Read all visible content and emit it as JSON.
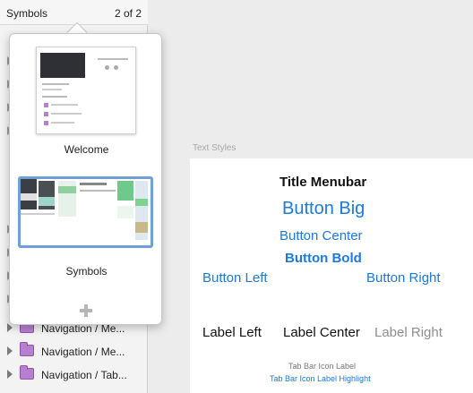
{
  "layers_panel": {
    "title": "Symbols",
    "page_counter": "2 of 2",
    "rows": [
      {
        "label": "Navigation / Me..."
      },
      {
        "label": "Navigation / Me..."
      },
      {
        "label": "Navigation / Tab..."
      }
    ]
  },
  "popover": {
    "pages": [
      {
        "name": "Welcome"
      },
      {
        "name": "Symbols"
      }
    ]
  },
  "artboard": {
    "title": "Text Styles",
    "styles": {
      "title_menubar": "Title Menubar",
      "button_big": "Button Big",
      "button_center": "Button Center",
      "button_bold": "Button Bold",
      "button_left": "Button Left",
      "button_right": "Button Right",
      "label_left": "Label Left",
      "label_center": "Label Center",
      "label_right": "Label Right",
      "tab_bar_icon_label": "Tab Bar Icon Label",
      "tab_bar_icon_label_highlight": "Tab Bar Icon Label Highlight"
    }
  },
  "colors": {
    "ios_blue": "#1a7ae0",
    "gray_text": "#8e8e8e",
    "folder_purple": "#b67fd0",
    "selection_blue": "#6e9fd6"
  }
}
